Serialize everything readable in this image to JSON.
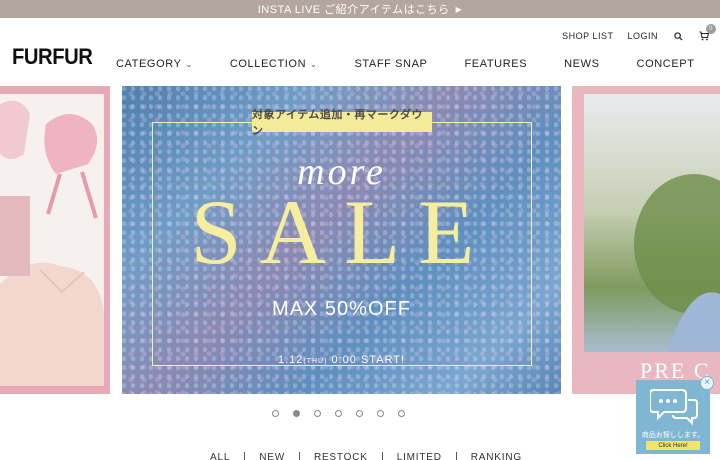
{
  "promo_bar": {
    "text": "INSTA LIVE ご紹介アイテムはこちら",
    "arrow": "▶"
  },
  "header": {
    "logo": "FURFUR",
    "util_links": [
      "SHOP LIST",
      "LOGIN"
    ],
    "search_icon": "search-icon",
    "cart_icon": "cart-icon",
    "cart_count": "0"
  },
  "main_nav": [
    {
      "label": "CATEGORY",
      "has_dropdown": true
    },
    {
      "label": "COLLECTION",
      "has_dropdown": true
    },
    {
      "label": "STAFF SNAP",
      "has_dropdown": false
    },
    {
      "label": "FEATURES",
      "has_dropdown": false
    },
    {
      "label": "NEWS",
      "has_dropdown": false
    },
    {
      "label": "CONCEPT",
      "has_dropdown": false
    }
  ],
  "hero": {
    "tag": "対象アイテム追加・再マークダウン",
    "script_word": "more",
    "headline": "SALE",
    "discount": "MAX 50%OFF",
    "start_date": "1.12",
    "start_day": "(THU)",
    "start_time": "0:00 START!"
  },
  "right_slide": {
    "text": "PRE C"
  },
  "carousel": {
    "dot_count": 7,
    "active_index": 1
  },
  "filter_tabs": [
    "ALL",
    "NEW",
    "RESTOCK",
    "LIMITED",
    "RANKING"
  ],
  "chat_widget": {
    "label": "商品お探しします。",
    "button": "Click Here!",
    "close": "×"
  },
  "colors": {
    "promo_bar": "#b2a69f",
    "sale_yellow": "#f5ee9f",
    "tag_yellow": "#f3ea9a",
    "chat_blue": "#7fb6d1",
    "pink_frame": "#e8a9b6"
  }
}
